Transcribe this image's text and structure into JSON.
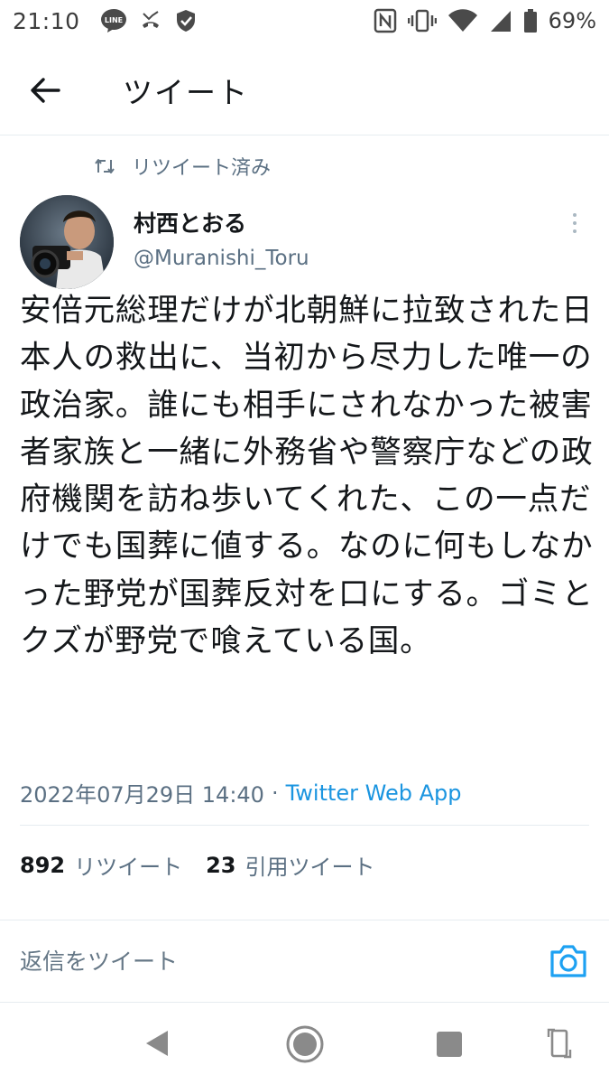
{
  "status_bar": {
    "time": "21:10",
    "line_badge": "LINE",
    "battery": "69%",
    "icons": [
      "line-icon",
      "missed-call-icon",
      "shield-icon",
      "nfc-icon",
      "vibrate-icon",
      "wifi-icon",
      "signal-icon",
      "battery-icon"
    ]
  },
  "header": {
    "title": "ツイート",
    "back_icon": "arrow-left-icon"
  },
  "tweet": {
    "retweet_label": "リツイート済み",
    "author_name": "村西とおる",
    "author_handle": "@Muranishi_Toru",
    "text": "安倍元総理だけが北朝鮮に拉致された日本人の救出に、当初から尽力した唯一の政治家。誰にも相手にされなかった被害者家族と一緒に外務省や警察庁などの政府機関を訪ね歩いてくれた、この一点だけでも国葬に値する。なのに何もしなかった野党が国葬反対を口にする。ゴミとクズが野党で喰えている国。",
    "timestamp": "2022年07月29日 14:40",
    "separator": "·",
    "source_app": "Twitter Web App"
  },
  "stats": {
    "retweets_count": "892",
    "retweets_label": "リツイート",
    "quotes_count": "23",
    "quotes_label": "引用ツイート"
  },
  "reply": {
    "placeholder": "返信をツイート"
  },
  "colors": {
    "accent": "#1DA1F2",
    "link": "#1b95e0",
    "muted": "#5b7083",
    "text": "#14171a"
  }
}
